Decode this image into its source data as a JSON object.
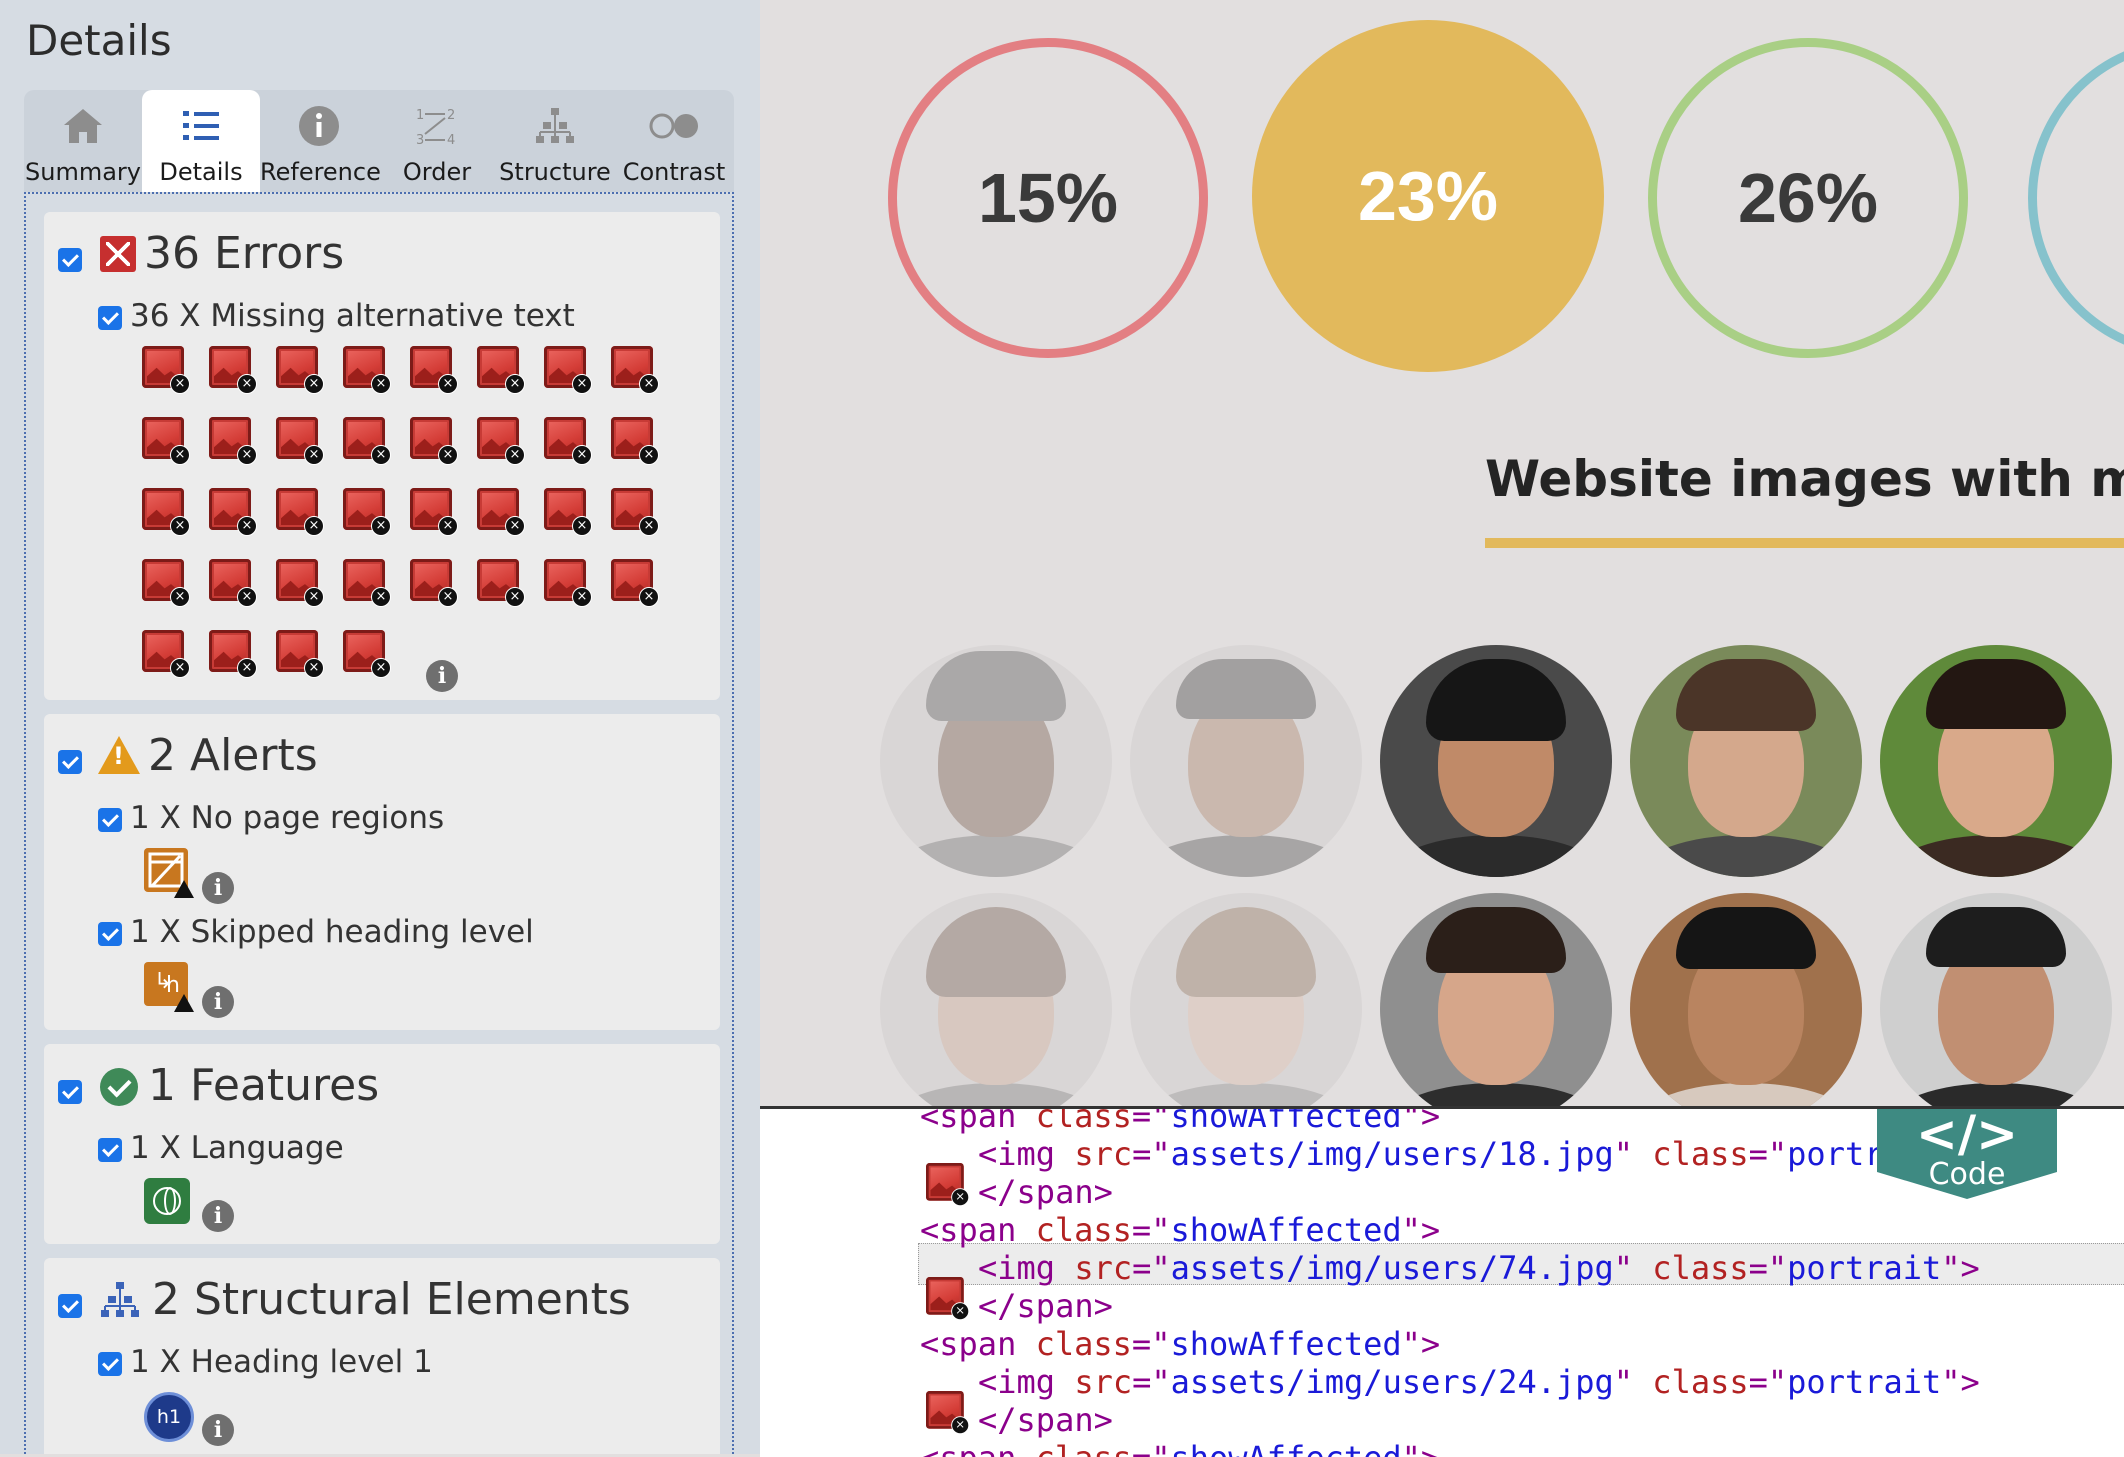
{
  "panel": {
    "title": "Details",
    "tabs": [
      {
        "label": "Summary",
        "icon": "home-icon"
      },
      {
        "label": "Details",
        "icon": "list-icon",
        "active": true
      },
      {
        "label": "Reference",
        "icon": "info-icon"
      },
      {
        "label": "Order",
        "icon": "order-icon"
      },
      {
        "label": "Structure",
        "icon": "structure-icon"
      },
      {
        "label": "Contrast",
        "icon": "contrast-icon"
      }
    ],
    "errors": {
      "title": "36 Errors",
      "items": [
        {
          "label": "36 X Missing alternative text",
          "count": 36,
          "icon": "missing-alt-image-icon"
        }
      ]
    },
    "alerts": {
      "title": "2 Alerts",
      "items": [
        {
          "label": "1 X No page regions",
          "icon": "no-page-regions-icon"
        },
        {
          "label": "1 X Skipped heading level",
          "icon": "skipped-heading-icon"
        }
      ]
    },
    "features": {
      "title": "1 Features",
      "items": [
        {
          "label": "1 X Language",
          "icon": "language-icon"
        }
      ]
    },
    "structure": {
      "title": "2 Structural Elements",
      "items": [
        {
          "label": "1 X Heading level 1",
          "icon_text": "h1"
        }
      ]
    }
  },
  "main": {
    "stats": [
      {
        "value": "15%",
        "color": "#e37f83",
        "style": "outline"
      },
      {
        "value": "23%",
        "color": "#e2b95c",
        "style": "filled"
      },
      {
        "value": "26%",
        "color": "#a9cf85",
        "style": "outline"
      },
      {
        "value": "",
        "color": "#86c2cc",
        "style": "outline"
      }
    ],
    "headline": "Website images with missin",
    "accent_color": "#e2b95c"
  },
  "code": {
    "lines": [
      {
        "indent": 0,
        "parts": [
          [
            "tag",
            "<span "
          ],
          [
            "attr",
            "class"
          ],
          [
            "tag",
            "=\""
          ],
          [
            "val",
            "showAffected"
          ],
          [
            "tag",
            "\">"
          ]
        ]
      },
      {
        "indent": 1,
        "error": true,
        "parts": [
          [
            "tag",
            "<img "
          ],
          [
            "attr",
            "src"
          ],
          [
            "tag",
            "=\""
          ],
          [
            "val",
            "assets/img/users/18.jpg"
          ],
          [
            "tag",
            "\" "
          ],
          [
            "attr",
            "class"
          ],
          [
            "tag",
            "=\""
          ],
          [
            "val",
            "portrait"
          ],
          [
            "tag",
            "\">"
          ]
        ]
      },
      {
        "indent": 1,
        "parts": [
          [
            "tag",
            "</span>"
          ]
        ]
      },
      {
        "indent": 0,
        "parts": [
          [
            "tag",
            "<span "
          ],
          [
            "attr",
            "class"
          ],
          [
            "tag",
            "=\""
          ],
          [
            "val",
            "showAffected"
          ],
          [
            "tag",
            "\">"
          ]
        ]
      },
      {
        "indent": 1,
        "error": true,
        "highlight": true,
        "parts": [
          [
            "tag",
            "<img "
          ],
          [
            "attr",
            "src"
          ],
          [
            "tag",
            "=\""
          ],
          [
            "val",
            "assets/img/users/74.jpg"
          ],
          [
            "tag",
            "\" "
          ],
          [
            "attr",
            "class"
          ],
          [
            "tag",
            "=\""
          ],
          [
            "val",
            "portrait"
          ],
          [
            "tag",
            "\">"
          ]
        ]
      },
      {
        "indent": 1,
        "parts": [
          [
            "tag",
            "</span>"
          ]
        ]
      },
      {
        "indent": 0,
        "parts": [
          [
            "tag",
            "<span "
          ],
          [
            "attr",
            "class"
          ],
          [
            "tag",
            "=\""
          ],
          [
            "val",
            "showAffected"
          ],
          [
            "tag",
            "\">"
          ]
        ]
      },
      {
        "indent": 1,
        "error": true,
        "parts": [
          [
            "tag",
            "<img "
          ],
          [
            "attr",
            "src"
          ],
          [
            "tag",
            "=\""
          ],
          [
            "val",
            "assets/img/users/24.jpg"
          ],
          [
            "tag",
            "\" "
          ],
          [
            "attr",
            "class"
          ],
          [
            "tag",
            "=\""
          ],
          [
            "val",
            "portrait"
          ],
          [
            "tag",
            "\">"
          ]
        ]
      },
      {
        "indent": 1,
        "parts": [
          [
            "tag",
            "</span>"
          ]
        ]
      },
      {
        "indent": 0,
        "parts": [
          [
            "tag",
            "<span "
          ],
          [
            "attr",
            "class"
          ],
          [
            "tag",
            "=\""
          ],
          [
            "val",
            "showAffected"
          ],
          [
            "tag",
            "\">"
          ]
        ]
      }
    ],
    "badge_symbol": "</>",
    "badge_label": "Code"
  }
}
